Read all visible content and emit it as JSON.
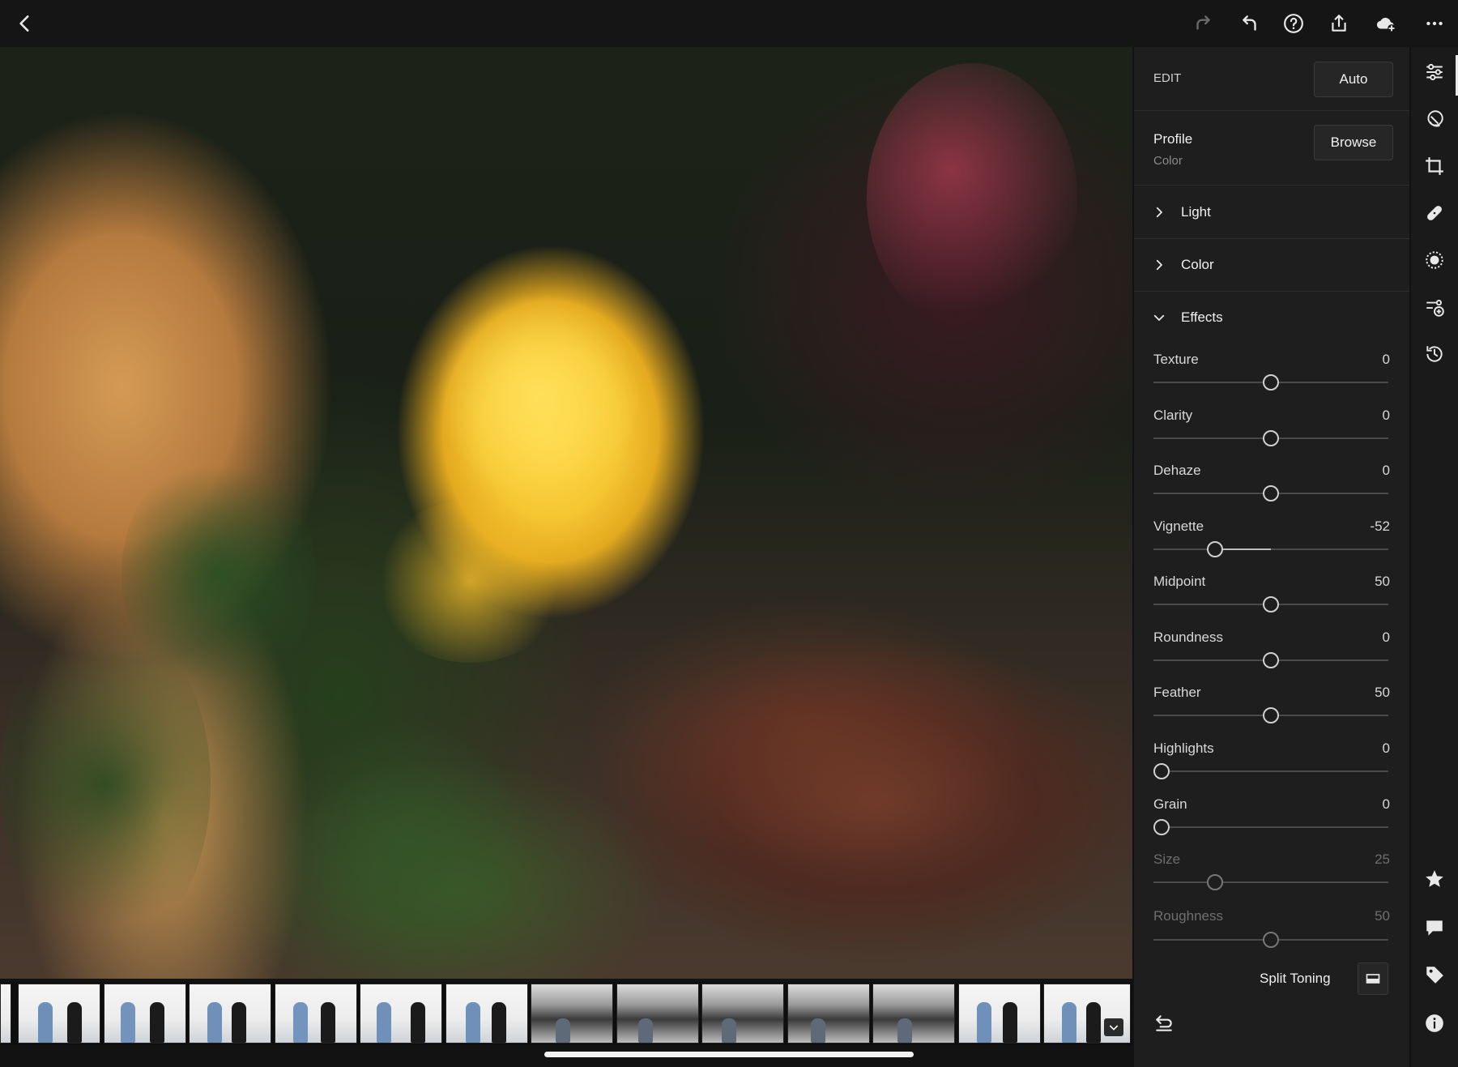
{
  "panel": {
    "header_label": "EDIT",
    "auto_label": "Auto",
    "profile": {
      "title": "Profile",
      "value": "Color",
      "browse_label": "Browse"
    },
    "sections": {
      "light": "Light",
      "color": "Color",
      "effects": "Effects"
    },
    "sliders": [
      {
        "label": "Texture",
        "value": "0"
      },
      {
        "label": "Clarity",
        "value": "0"
      },
      {
        "label": "Dehaze",
        "value": "0"
      },
      {
        "label": "Vignette",
        "value": "-52"
      },
      {
        "label": "Midpoint",
        "value": "50"
      },
      {
        "label": "Roundness",
        "value": "0"
      },
      {
        "label": "Feather",
        "value": "50"
      },
      {
        "label": "Highlights",
        "value": "0"
      },
      {
        "label": "Grain",
        "value": "0"
      },
      {
        "label": "Size",
        "value": "25"
      },
      {
        "label": "Roughness",
        "value": "50"
      }
    ],
    "split_toning_label": "Split Toning"
  },
  "icons": {
    "top": [
      "back-icon",
      "redo-icon",
      "undo-icon",
      "help-icon",
      "share-icon",
      "cloud-add-icon",
      "more-icon"
    ],
    "rail": [
      "edit-sliders-icon",
      "presets-icon",
      "crop-icon",
      "healing-icon",
      "masking-icon",
      "selective-icon",
      "versions-icon",
      "star-icon",
      "comment-icon",
      "tag-icon",
      "info-icon"
    ]
  }
}
